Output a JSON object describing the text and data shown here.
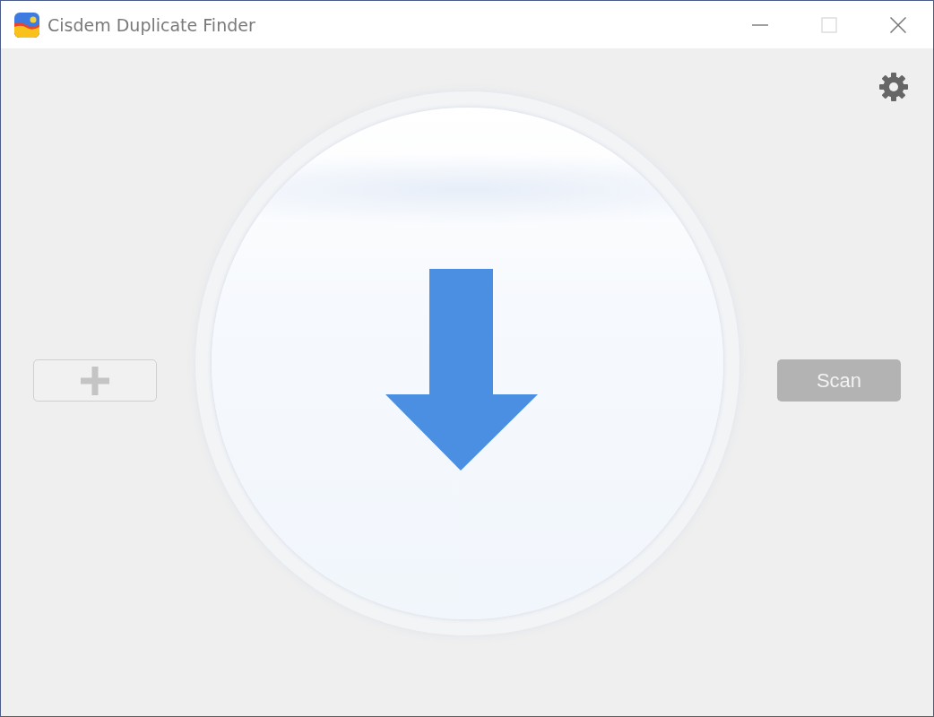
{
  "window": {
    "title": "Cisdem Duplicate Finder",
    "maximize_disabled": true
  },
  "scan_button": {
    "label": "Scan",
    "disabled": true
  }
}
